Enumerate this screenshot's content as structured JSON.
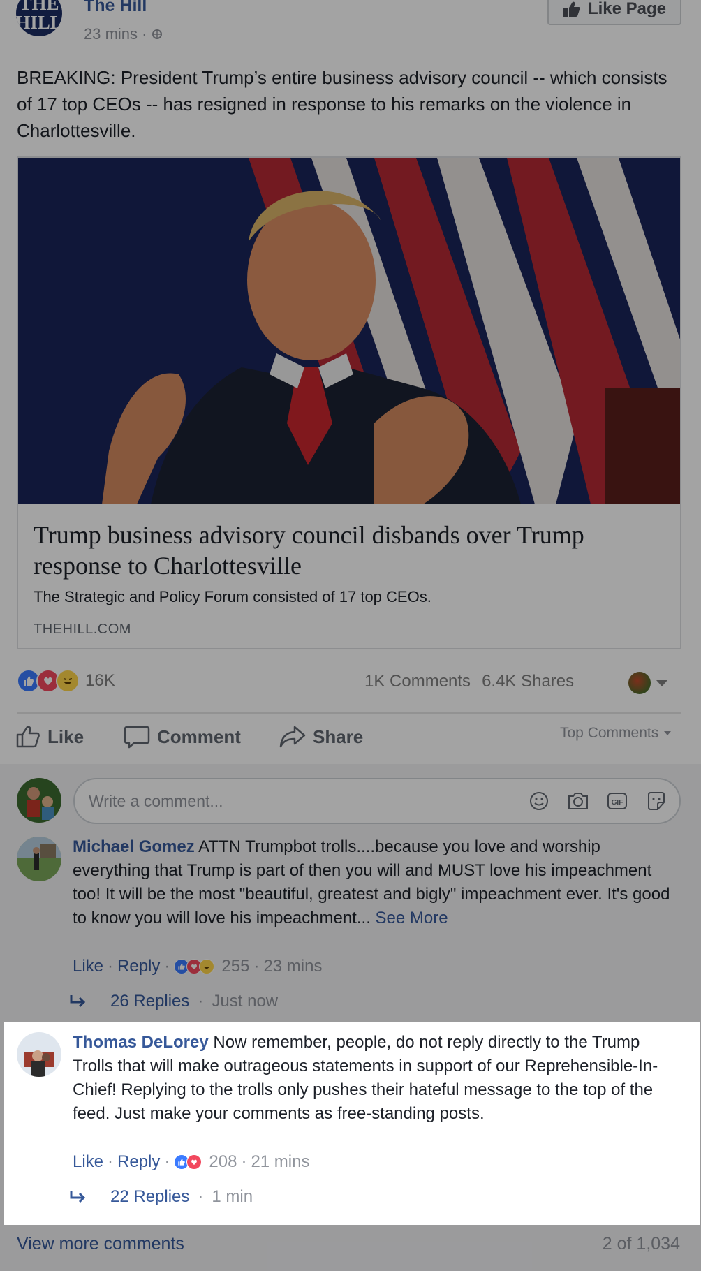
{
  "post": {
    "page_name": "The Hill",
    "page_avatar_text": "THE HILL",
    "time": "23 mins ·",
    "privacy_icon": "globe-icon",
    "like_page_label": "Like Page",
    "text": "BREAKING: President Trump’s entire business advisory council -- which consists of 17 top CEOs -- has resigned in response to his remarks on the violence in Charlottesville."
  },
  "link_preview": {
    "title": "Trump business advisory council disbands over Trump response to Charlottesville",
    "description": "The Strategic and Policy Forum consisted of 17 top CEOs.",
    "domain": "THEHILL.COM"
  },
  "engagement": {
    "reaction_count": "16K",
    "comments": "1K Comments",
    "shares": "6.4K Shares",
    "reaction_icons": [
      "like-icon",
      "love-icon",
      "haha-icon"
    ]
  },
  "actions": {
    "like": "Like",
    "comment": "Comment",
    "share": "Share",
    "sort": "Top Comments"
  },
  "composer": {
    "placeholder": "Write a comment...",
    "icons": [
      "emoji-icon",
      "camera-icon",
      "gif-icon",
      "sticker-icon"
    ]
  },
  "comments": [
    {
      "author": "Michael Gomez",
      "text": " ATTN Trumpbot trolls....because you love and worship everything that Trump is part of then you will and MUST love his impeachment too! It will be the most \"beautiful, greatest and bigly\" impeachment ever. It's good to know you will love his impeachment...",
      "see_more": " See More",
      "like": "Like",
      "reply": "Reply",
      "reaction_count": "255",
      "time": "23 mins",
      "replies": "26 Replies",
      "replies_time": "Just now"
    },
    {
      "author": "Thomas DeLorey",
      "text": " Now remember, people, do not reply directly to the Trump Trolls that will make outrageous statements in support of our Reprehensible-In-Chief! Replying to the trolls only pushes their hateful message to the top of the feed. Just make your comments as free-standing posts.",
      "like": "Like",
      "reply": "Reply",
      "reaction_count": "208",
      "time": "21 mins",
      "replies": "22 Replies",
      "replies_time": "1 min"
    }
  ],
  "footer": {
    "view_more": "View more comments",
    "position": "2 of 1,034"
  },
  "colors": {
    "link_blue": "#365899",
    "like_blue": "#3b7bff",
    "love_red": "#f2485e",
    "haha_yellow": "#ffd54a",
    "meta_grey": "#90949c"
  }
}
